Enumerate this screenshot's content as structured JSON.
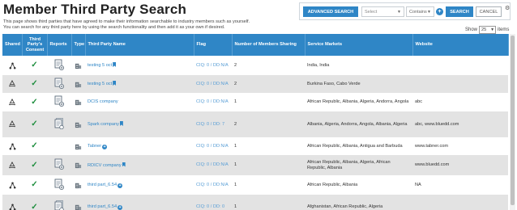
{
  "page": {
    "title": "Member Third Party Search",
    "description_line1": "This page shows third parties that have agreed to make their information searchable to industry members such as yourself.",
    "description_line2": "You can search for any third party here by using the search functionality and then add it as your own if desired."
  },
  "search": {
    "advanced_label": "ADVANCED SEARCH",
    "field_placeholder": "Select",
    "operator_value": "Contains",
    "search_label": "SEARCH",
    "cancel_label": "CANCEL"
  },
  "pagination": {
    "show_label": "Show",
    "page_size": "25",
    "items_label": "items"
  },
  "columns": {
    "shared": "Shared",
    "consent": "Third Party's Consent",
    "reports": "Reports",
    "type": "Type",
    "name": "Third Party Name",
    "flag": "Flag",
    "members": "Number of Members Sharing",
    "markets": "Service Markets",
    "website": "Website"
  },
  "rows": [
    {
      "share_icon": "share-icon",
      "consent": "✓",
      "report_icon": "report-doc-icon",
      "name": "testing 5 oct",
      "name_badge": "bookmark",
      "flag": "CIQ: 0 / DD:N/A",
      "members": "2",
      "markets": "India, India",
      "website": ""
    },
    {
      "share_icon": "recycle-icon",
      "consent": "✓",
      "report_icon": "report-doc-icon",
      "name": "testing 5 oct",
      "name_badge": "bookmark",
      "flag": "CIQ: 0 / DD:N/A",
      "members": "2",
      "markets": "Burkina Faso, Cabo Verde",
      "website": ""
    },
    {
      "share_icon": "recycle-icon",
      "consent": "✓",
      "report_icon": "report-doc-icon",
      "name": "DCIS company",
      "name_badge": "",
      "flag": "CIQ: 0 / DD:N/A",
      "members": "1",
      "markets": "African Republic, Albania, Algeria, Andorra, Angola",
      "website": "abc"
    },
    {
      "share_icon": "recycle-icon",
      "consent": "✓",
      "report_icon": "report-doc-stack-icon",
      "name": "Spark company",
      "name_badge": "bookmark",
      "flag": "CIQ: 0 / DD: 7",
      "members": "2",
      "markets": "Albania, Algeria, Andorra, Angola, Albania, Algeria",
      "website": "abc, www.bluedd.com"
    },
    {
      "share_icon": "share-icon",
      "consent": "✓",
      "report_icon": "",
      "name": "Tabner",
      "name_badge": "plus",
      "flag": "CIQ: 0 / DD:N/A",
      "members": "1",
      "markets": "African Republic, Albania, Antigua and Barbuda",
      "website": "www.tabner.com"
    },
    {
      "share_icon": "recycle-icon",
      "consent": "✓",
      "report_icon": "report-doc-icon",
      "name": "RDICV company",
      "name_badge": "bookmark",
      "flag": "CIQ: 0 / DD:N/A",
      "members": "1",
      "markets": "African Republic, Albania, Algeria, African Republic, Albania",
      "website": "www.bluedd.com"
    },
    {
      "share_icon": "share-icon",
      "consent": "✓",
      "report_icon": "report-doc-icon",
      "name": "third part_6.54",
      "name_badge": "plus",
      "flag": "CIQ: 0 / DD:N/A",
      "members": "1",
      "markets": "African Republic, Albania",
      "website": "NA"
    },
    {
      "share_icon": "share-icon",
      "consent": "✓",
      "report_icon": "report-doc-stack-icon",
      "name": "third part_6.54",
      "name_badge": "plus",
      "flag": "CIQ: 0 / DD: 0",
      "members": "1",
      "markets": "Afghanistan, African Republic, Algeria",
      "website": ""
    }
  ],
  "colors": {
    "accent": "#2f86c6",
    "check": "#1e8e3e",
    "row_alt": "#e3e3e3"
  }
}
